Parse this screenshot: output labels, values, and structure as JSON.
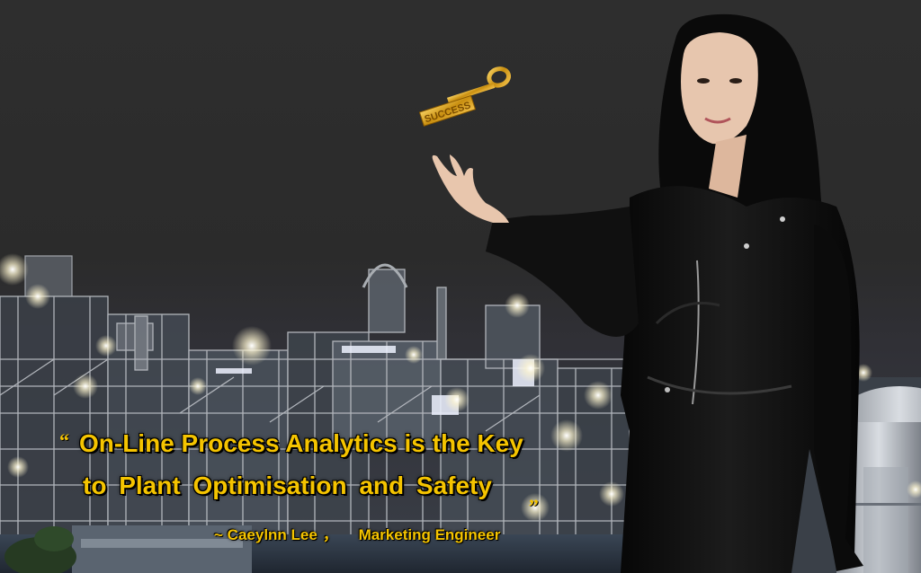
{
  "quote": {
    "open_mark": "“",
    "line1": "On-Line Process Analytics is the Key",
    "line2": "to  Plant  Optimisation  and  Safety",
    "close_mark": "„"
  },
  "attribution": {
    "tilde": "~",
    "name": "Caeylnn Lee",
    "separator": "，",
    "role": "Marketing Engineer"
  },
  "key_engraving": "SUCCESS",
  "colors": {
    "quote_text": "#f5c400",
    "sky": "#2b2b2b",
    "jacket": "#0d0d0d",
    "key": "#d9a520"
  }
}
